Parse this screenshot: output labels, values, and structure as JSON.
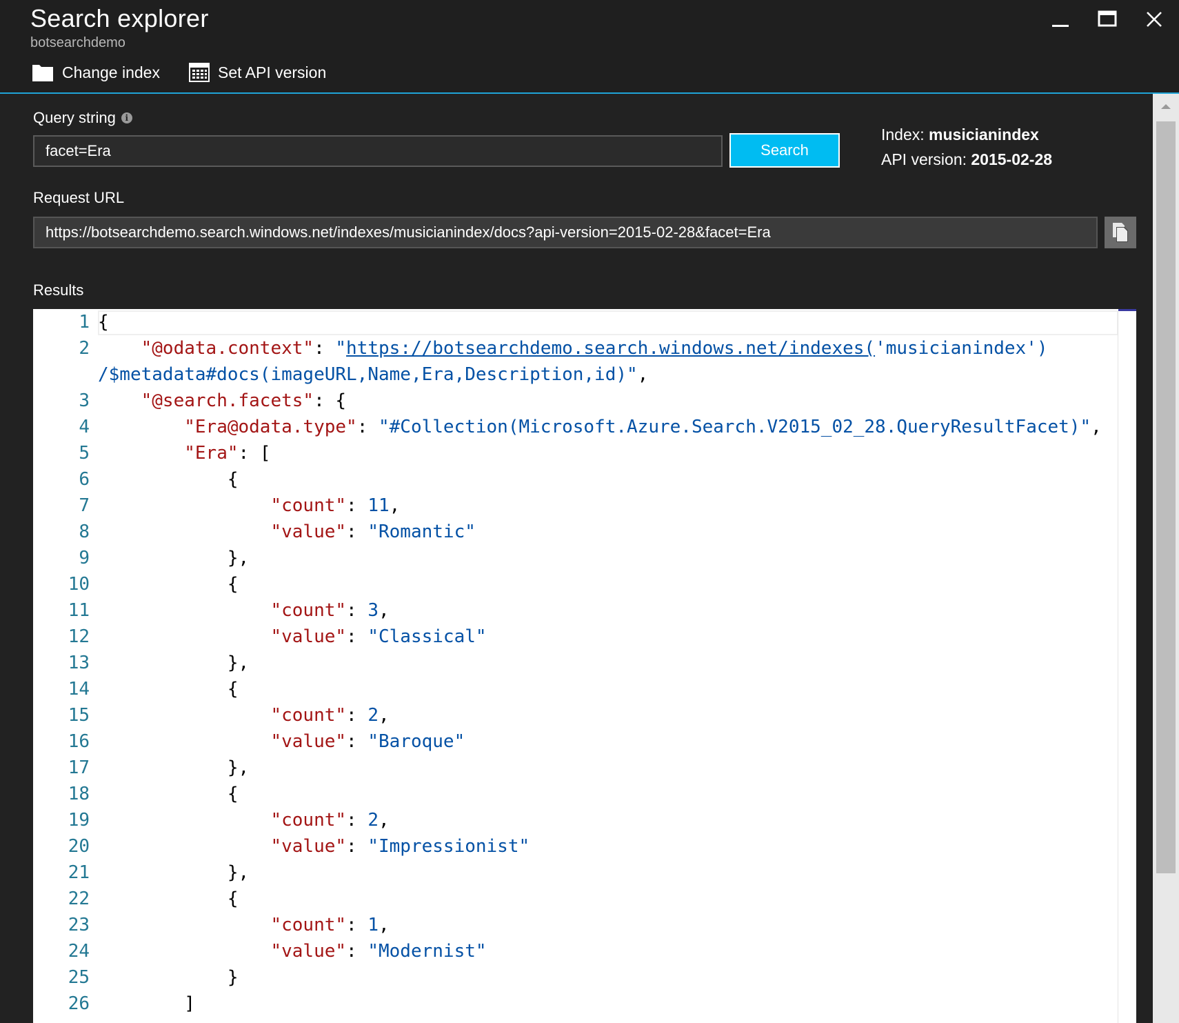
{
  "window": {
    "title": "Search explorer",
    "subtitle": "botsearchdemo"
  },
  "toolbar": {
    "change_index_label": "Change index",
    "set_api_label": "Set API version"
  },
  "query": {
    "label": "Query string",
    "info_glyph": "i",
    "value": "facet=Era",
    "search_label": "Search"
  },
  "meta": {
    "index_label": "Index:",
    "index_value": "musicianindex",
    "api_label": "API version:",
    "api_value": "2015-02-28"
  },
  "request": {
    "label": "Request URL",
    "url": "https://botsearchdemo.search.windows.net/indexes/musicianindex/docs?api-version=2015-02-28&facet=Era"
  },
  "results": {
    "label": "Results",
    "lines": [
      {
        "n": "1",
        "parts": [
          [
            "txt",
            "{"
          ]
        ]
      },
      {
        "n": "2",
        "parts": [
          [
            "txt",
            "    "
          ],
          [
            "k",
            "\"@odata.context\""
          ],
          [
            "txt",
            ": "
          ],
          [
            "s",
            "\""
          ],
          [
            "u",
            "https://botsearchdemo.search.windows.net/indexes("
          ],
          [
            "s",
            "'musicianindex')"
          ]
        ]
      },
      {
        "n": "",
        "parts": [
          [
            "s",
            "/$metadata#docs(imageURL,Name,Era,Description,id)\""
          ],
          [
            "txt",
            ","
          ]
        ]
      },
      {
        "n": "3",
        "parts": [
          [
            "txt",
            "    "
          ],
          [
            "k",
            "\"@search.facets\""
          ],
          [
            "txt",
            ": {"
          ]
        ]
      },
      {
        "n": "4",
        "parts": [
          [
            "txt",
            "        "
          ],
          [
            "k",
            "\"Era@odata.type\""
          ],
          [
            "txt",
            ": "
          ],
          [
            "s",
            "\"#Collection(Microsoft.Azure.Search.V2015_02_28.QueryResultFacet)\""
          ],
          [
            "txt",
            ","
          ]
        ]
      },
      {
        "n": "5",
        "parts": [
          [
            "txt",
            "        "
          ],
          [
            "k",
            "\"Era\""
          ],
          [
            "txt",
            ": ["
          ]
        ]
      },
      {
        "n": "6",
        "parts": [
          [
            "txt",
            "            {"
          ]
        ]
      },
      {
        "n": "7",
        "parts": [
          [
            "txt",
            "                "
          ],
          [
            "k",
            "\"count\""
          ],
          [
            "txt",
            ": "
          ],
          [
            "s",
            "11"
          ],
          [
            "txt",
            ","
          ]
        ]
      },
      {
        "n": "8",
        "parts": [
          [
            "txt",
            "                "
          ],
          [
            "k",
            "\"value\""
          ],
          [
            "txt",
            ": "
          ],
          [
            "s",
            "\"Romantic\""
          ]
        ]
      },
      {
        "n": "9",
        "parts": [
          [
            "txt",
            "            },"
          ]
        ]
      },
      {
        "n": "10",
        "parts": [
          [
            "txt",
            "            {"
          ]
        ]
      },
      {
        "n": "11",
        "parts": [
          [
            "txt",
            "                "
          ],
          [
            "k",
            "\"count\""
          ],
          [
            "txt",
            ": "
          ],
          [
            "s",
            "3"
          ],
          [
            "txt",
            ","
          ]
        ]
      },
      {
        "n": "12",
        "parts": [
          [
            "txt",
            "                "
          ],
          [
            "k",
            "\"value\""
          ],
          [
            "txt",
            ": "
          ],
          [
            "s",
            "\"Classical\""
          ]
        ]
      },
      {
        "n": "13",
        "parts": [
          [
            "txt",
            "            },"
          ]
        ]
      },
      {
        "n": "14",
        "parts": [
          [
            "txt",
            "            {"
          ]
        ]
      },
      {
        "n": "15",
        "parts": [
          [
            "txt",
            "                "
          ],
          [
            "k",
            "\"count\""
          ],
          [
            "txt",
            ": "
          ],
          [
            "s",
            "2"
          ],
          [
            "txt",
            ","
          ]
        ]
      },
      {
        "n": "16",
        "parts": [
          [
            "txt",
            "                "
          ],
          [
            "k",
            "\"value\""
          ],
          [
            "txt",
            ": "
          ],
          [
            "s",
            "\"Baroque\""
          ]
        ]
      },
      {
        "n": "17",
        "parts": [
          [
            "txt",
            "            },"
          ]
        ]
      },
      {
        "n": "18",
        "parts": [
          [
            "txt",
            "            {"
          ]
        ]
      },
      {
        "n": "19",
        "parts": [
          [
            "txt",
            "                "
          ],
          [
            "k",
            "\"count\""
          ],
          [
            "txt",
            ": "
          ],
          [
            "s",
            "2"
          ],
          [
            "txt",
            ","
          ]
        ]
      },
      {
        "n": "20",
        "parts": [
          [
            "txt",
            "                "
          ],
          [
            "k",
            "\"value\""
          ],
          [
            "txt",
            ": "
          ],
          [
            "s",
            "\"Impressionist\""
          ]
        ]
      },
      {
        "n": "21",
        "parts": [
          [
            "txt",
            "            },"
          ]
        ]
      },
      {
        "n": "22",
        "parts": [
          [
            "txt",
            "            {"
          ]
        ]
      },
      {
        "n": "23",
        "parts": [
          [
            "txt",
            "                "
          ],
          [
            "k",
            "\"count\""
          ],
          [
            "txt",
            ": "
          ],
          [
            "s",
            "1"
          ],
          [
            "txt",
            ","
          ]
        ]
      },
      {
        "n": "24",
        "parts": [
          [
            "txt",
            "                "
          ],
          [
            "k",
            "\"value\""
          ],
          [
            "txt",
            ": "
          ],
          [
            "s",
            "\"Modernist\""
          ]
        ]
      },
      {
        "n": "25",
        "parts": [
          [
            "txt",
            "            }"
          ]
        ]
      },
      {
        "n": "26",
        "parts": [
          [
            "txt",
            "        ]"
          ]
        ]
      }
    ]
  },
  "icons": {
    "minimize": "minimize-icon",
    "maximize": "maximize-icon",
    "close": "close-icon",
    "folder": "folder-icon",
    "calendar": "calendar-icon",
    "copy": "copy-icon",
    "scroll_up": "chevron-up-icon"
  },
  "colors": {
    "accent": "#1fa5d8",
    "search_button": "#00bcf2",
    "json_key": "#a31515",
    "json_value": "#0451a5",
    "line_number": "#237893"
  }
}
